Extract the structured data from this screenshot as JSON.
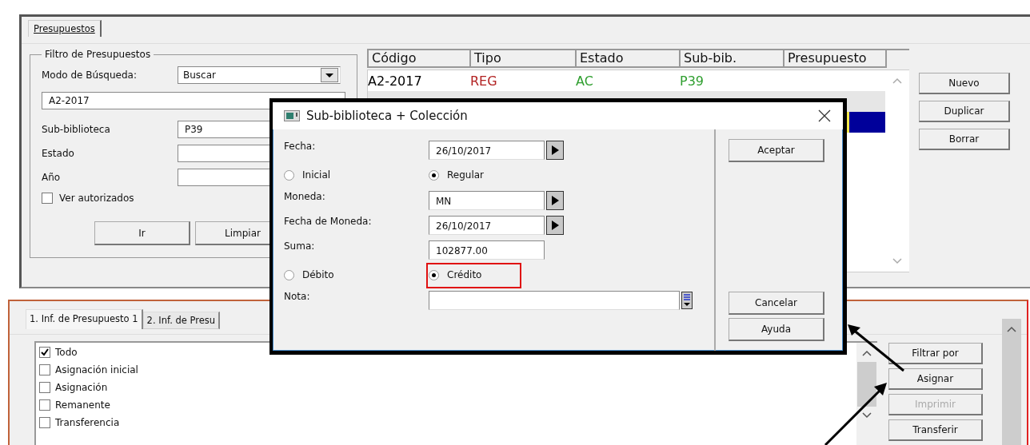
{
  "top_panel": {
    "tabs": [
      {
        "label": "Presupuestos",
        "selected": true
      }
    ],
    "filter": {
      "title": "Filtro de Presupuestos",
      "search_mode": {
        "label": "Modo de Búsqueda:",
        "value": "Buscar"
      },
      "code_field": {
        "value": "A2-2017"
      },
      "fields": [
        {
          "label": "Sub-biblioteca",
          "value": "P39"
        },
        {
          "label": "Estado"
        },
        {
          "label": "Año"
        }
      ],
      "checkbox": {
        "label": "Ver autorizados",
        "checked": false
      },
      "buttons": [
        "Ir",
        "Limpiar"
      ]
    },
    "table": {
      "columns": [
        "Código",
        "Tipo",
        "Estado",
        "Sub-bib.",
        "Presupuesto"
      ],
      "rows": [
        {
          "cells": [
            {
              "text": "A2-2017"
            },
            {
              "text": "REG",
              "color": "#b22222"
            },
            {
              "text": "AC",
              "color": "#2e9e2e"
            },
            {
              "text": "P39",
              "color": "#2e9e2e"
            }
          ],
          "selected": false
        },
        {
          "selected": false
        },
        {
          "selected": true
        }
      ]
    },
    "buttons": [
      "Nuevo",
      "Duplicar",
      "Borrar"
    ]
  },
  "bottom_panel": {
    "tabs": [
      {
        "label": "1. Inf. de Presupuesto 1",
        "selected": true
      },
      {
        "label": "2. Inf. de Presu",
        "selected": false
      }
    ],
    "checklist": [
      {
        "label": "Todo",
        "checked": true
      },
      {
        "label": "Asignación inicial",
        "checked": false
      },
      {
        "label": "Asignación",
        "checked": false
      },
      {
        "label": "Remanente",
        "checked": false
      },
      {
        "label": "Transferencia",
        "checked": false
      }
    ],
    "buttons": [
      {
        "label": "Filtrar por",
        "disabled": false
      },
      {
        "label": "Asignar",
        "disabled": false
      },
      {
        "label": "Imprimir",
        "disabled": true
      },
      {
        "label": "Transferir",
        "disabled": false
      }
    ]
  },
  "dialog": {
    "title": "Sub-biblioteca + Colección",
    "rows": [
      {
        "kind": "field",
        "label": "Fecha:",
        "value": "26/10/2017",
        "arrow": true
      },
      {
        "kind": "radios",
        "options": [
          {
            "label": "Inicial",
            "selected": false,
            "highlighted": false
          },
          {
            "label": "Regular",
            "selected": true,
            "highlighted": false
          }
        ]
      },
      {
        "kind": "field",
        "label": "Moneda:",
        "value": "MN",
        "arrow": true
      },
      {
        "kind": "field",
        "label": "Fecha de Moneda:",
        "value": "26/10/2017",
        "arrow": true
      },
      {
        "kind": "field",
        "label": "Suma:",
        "value": "102877.00",
        "arrow": false
      },
      {
        "kind": "radios",
        "options": [
          {
            "label": "Débito",
            "selected": false,
            "highlighted": false
          },
          {
            "label": "Crédito",
            "selected": true,
            "highlighted": true
          }
        ]
      },
      {
        "kind": "note",
        "label": "Nota:"
      }
    ],
    "buttons_top": [
      "Aceptar"
    ],
    "buttons_bottom": [
      "Cancelar",
      "Ayuda"
    ]
  }
}
